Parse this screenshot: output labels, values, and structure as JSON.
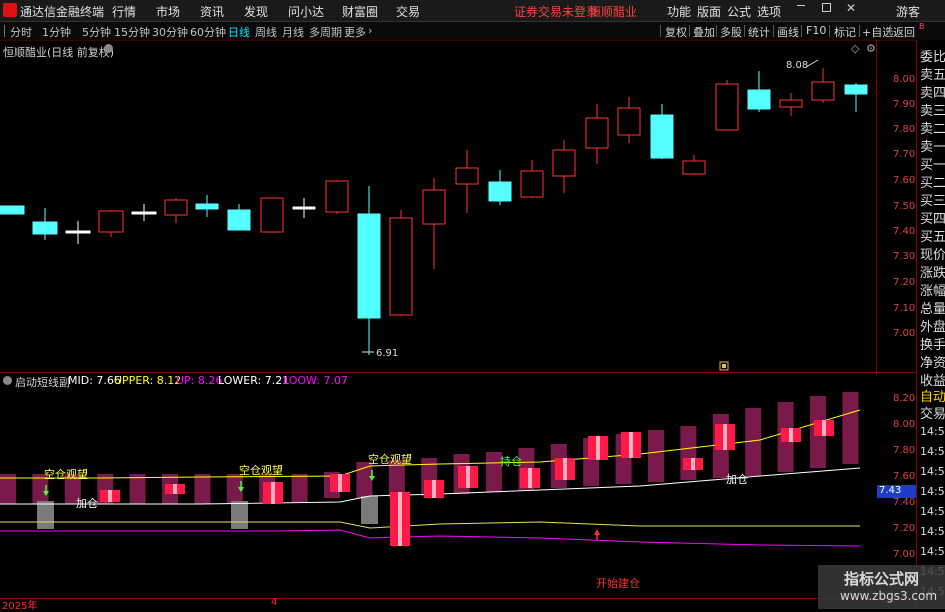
{
  "app": {
    "name": "通达信金融终端",
    "menu": [
      "行情",
      "市场",
      "资讯",
      "发现",
      "问小达",
      "财富圈",
      "交易"
    ],
    "notice": "证券交易未登录",
    "stock_name": "恒顺醋业",
    "right_menu": [
      "功能",
      "版面",
      "公式",
      "选项"
    ],
    "guest": "游客"
  },
  "periods": {
    "items": [
      "分时",
      "1分钟",
      "5分钟",
      "15分钟",
      "30分钟",
      "60分钟",
      "日线",
      "周线",
      "月线",
      "多周期",
      "更多"
    ],
    "active": "日线",
    "more_icon": "chevron-right-icon"
  },
  "toolbar": {
    "items": [
      "复权",
      "叠加",
      "多股",
      "统计",
      "画线",
      "F10",
      "标记",
      "+自选",
      "返回"
    ]
  },
  "main_chart": {
    "title": "恒顺醋业(日线 前复权)",
    "price_axis": [
      "8.00",
      "7.90",
      "7.80",
      "7.70",
      "7.60",
      "7.50",
      "7.40",
      "7.30",
      "7.20",
      "7.10",
      "7.00"
    ],
    "high_label": "8.08",
    "low_label": "6.91",
    "colors": {
      "up": "#ff3232",
      "down": "#54ffff",
      "doji": "#ffffff"
    }
  },
  "indicator": {
    "name": "启动短线副",
    "legend": [
      {
        "label": "MID: 7.66",
        "color": "#ffffff"
      },
      {
        "label": "UPPER: 8.12",
        "color": "#ffff00"
      },
      {
        "label": "UP: 8.26",
        "color": "#ff00ff"
      },
      {
        "label": "LOWER: 7.21",
        "color": "#ffffff"
      },
      {
        "label": "LOOW: 7.07",
        "color": "#ff00ff"
      }
    ],
    "axis": [
      "8.20",
      "8.00",
      "7.80",
      "7.60",
      "7.40",
      "7.20",
      "7.00"
    ],
    "current_value": "7.43",
    "annotations": {
      "empty_watch": "空仓观望",
      "add_position": "加仓",
      "hold": "持仓",
      "start_position": "开始建仓"
    }
  },
  "right_panel": {
    "labels": [
      "委比",
      "卖五",
      "卖四",
      "卖三",
      "卖二",
      "卖一",
      "买一",
      "买二",
      "买三",
      "买四",
      "买五",
      "现价",
      "涨跌",
      "涨幅",
      "总量",
      "外盘",
      "换手",
      "净资",
      "收益"
    ],
    "lower_labels": [
      "自动",
      "交易"
    ],
    "times": [
      "14:5",
      "14:5",
      "14:5",
      "14:5",
      "14:5",
      "14:5",
      "14:5",
      "14:5",
      "14:5"
    ],
    "top_label": "B"
  },
  "footer": {
    "year": "2025年",
    "month": "4"
  },
  "watermark": {
    "title": "指标公式网",
    "url": "www.zbgs3.com"
  }
}
